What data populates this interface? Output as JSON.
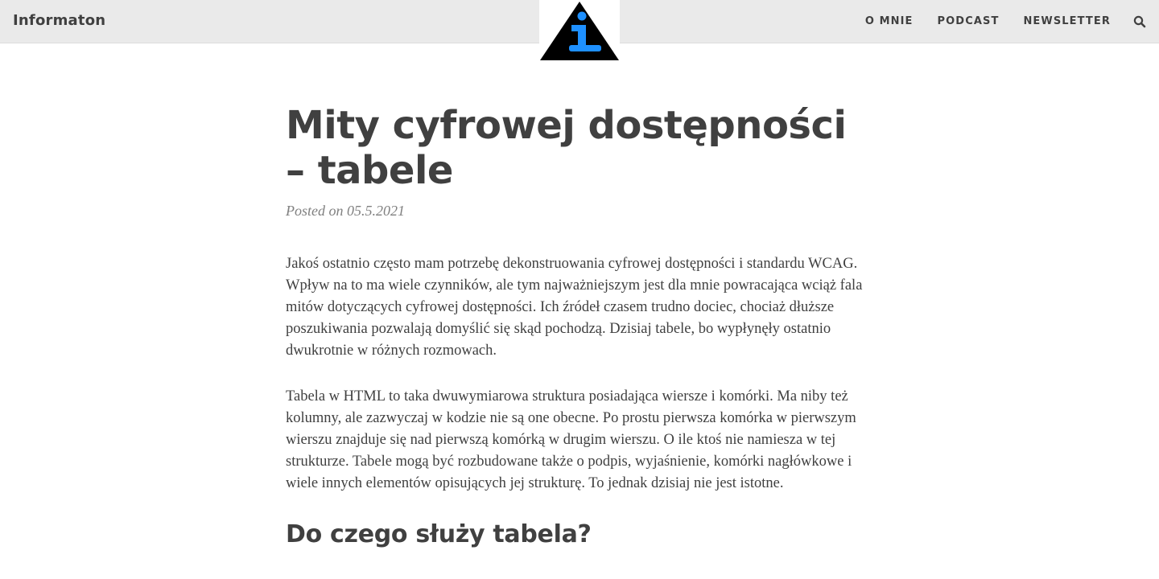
{
  "navbar": {
    "brand": "Informaton",
    "links": [
      {
        "label": "O MNIE"
      },
      {
        "label": "PODCAST"
      },
      {
        "label": "NEWSLETTER"
      }
    ],
    "search_icon": "search-icon",
    "logo_icon": "info-triangle-logo"
  },
  "colors": {
    "navbar_bg": "#eaeaea",
    "text": "#404040",
    "meta": "#808080",
    "logo_accent": "#1e90ff",
    "logo_dark": "#000000"
  },
  "article": {
    "title": "Mity cyfrowej dostępności – tabele",
    "meta": "Posted on 05.5.2021",
    "paragraphs": [
      "Jakoś ostatnio często mam potrzebę dekonstruowania cyfrowej dostępności i standardu WCAG. Wpływ na to ma wiele czynników, ale tym najważniejszym jest dla mnie powracająca wciąż fala mitów dotyczących cyfrowej dostępności. Ich źródeł czasem trudno dociec, chociaż dłuższe poszukiwania pozwalają domyślić się skąd pochodzą. Dzisiaj tabele, bo wypłynęły ostatnio dwukrotnie w różnych rozmowach.",
      "Tabela w HTML to taka dwuwymiarowa struktura posiadająca wiersze i komórki. Ma niby też kolumny, ale zazwyczaj w kodzie nie są one obecne. Po prostu pierwsza komórka w pierwszym wierszu znajduje się nad pierwszą komórką w drugim wierszu. O ile ktoś nie namiesza w tej strukturze. Tabele mogą być rozbudowane także o podpis, wyjaśnienie, komórki nagłówkowe i wiele innych elementów opisujących jej strukturę. To jednak dzisiaj nie jest istotne."
    ],
    "section_heading": "Do czego służy tabela?"
  }
}
